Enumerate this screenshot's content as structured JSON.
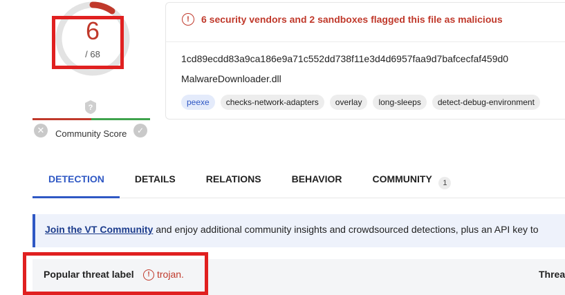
{
  "score": {
    "detections": "6",
    "total": "/ 68"
  },
  "community": {
    "label": "Community Score",
    "help_icon": "question-icon",
    "down_icon": "x-icon",
    "up_icon": "check-icon"
  },
  "alert": {
    "icon": "warning-circle-icon",
    "text": "6 security vendors and 2 sandboxes flagged this file as malicious"
  },
  "file": {
    "hash": "1cd89ecdd83a9ca186e9a71c552dd738f11e3d4d6957faa9d7bafcecfaf459d0",
    "name": "MalwareDownloader.dll",
    "tags": [
      "peexe",
      "checks-network-adapters",
      "overlay",
      "long-sleeps",
      "detect-debug-environment"
    ]
  },
  "tabs": {
    "detection": "DETECTION",
    "details": "DETAILS",
    "relations": "RELATIONS",
    "behavior": "BEHAVIOR",
    "community": "COMMUNITY",
    "community_count": "1"
  },
  "banner": {
    "link": "Join the VT Community",
    "text": " and enjoy additional community insights and crowdsourced detections, plus an API key to"
  },
  "threat": {
    "label": "Popular threat label",
    "value": "trojan.",
    "right_header": "Threa"
  },
  "colors": {
    "malicious": "#c0392b",
    "accent": "#2f58c4",
    "highlight": "#e02020"
  }
}
